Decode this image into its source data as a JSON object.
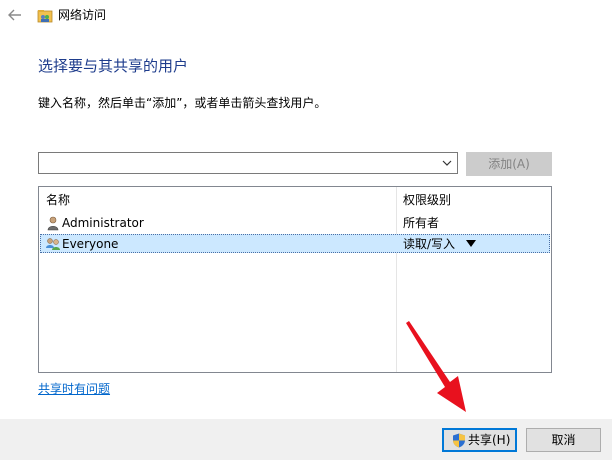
{
  "window": {
    "title": "网络访问",
    "back_icon": "back-arrow-icon",
    "app_icon": "network-sharing-icon"
  },
  "main": {
    "heading": "选择要与其共享的用户",
    "instruction": "键入名称，然后单击“添加”，或者单击箭头查找用户。"
  },
  "user_input": {
    "value": "",
    "placeholder": "",
    "dropdown_icon": "chevron-down-icon"
  },
  "add_button": {
    "label": "添加(A)",
    "enabled": false
  },
  "user_list": {
    "columns": [
      "名称",
      "权限级别"
    ],
    "rows": [
      {
        "name": "Administrator",
        "permission": "所有者",
        "icon": "user-icon",
        "selected": false
      },
      {
        "name": "Everyone",
        "permission": "读取/写入",
        "icon": "group-icon",
        "selected": true,
        "has_dropdown": true
      }
    ]
  },
  "help_link": {
    "label": "共享时有问题"
  },
  "buttons": {
    "share_label": "共享(H)",
    "share_icon": "uac-shield-icon",
    "cancel_label": "取消"
  },
  "colors": {
    "heading": "#1e3c8c",
    "link": "#0066cc",
    "selection": "#cce8ff",
    "focus_border": "#0078d7",
    "annotation_arrow": "#e8111e"
  }
}
